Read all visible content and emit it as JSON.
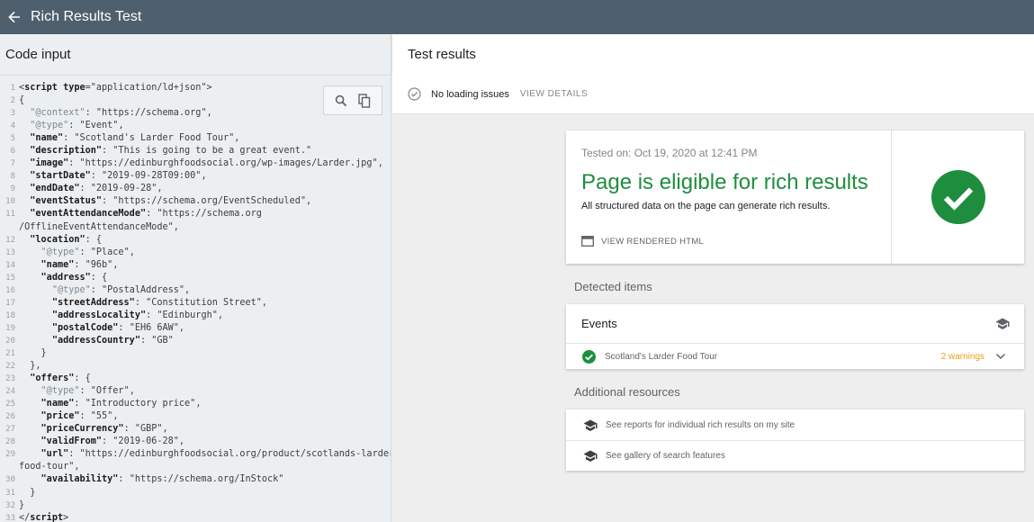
{
  "topbar": {
    "title": "Rich Results Test"
  },
  "code_panel": {
    "title": "Code input",
    "lines": [
      [
        [
          "p",
          "<"
        ],
        [
          "k",
          "script "
        ],
        [
          "k",
          "type"
        ],
        [
          "p",
          "=\"application/ld+json\">"
        ]
      ],
      [
        [
          "p",
          "{"
        ]
      ],
      [
        [
          "p",
          "  "
        ],
        [
          "kc",
          "\"@context\""
        ],
        [
          "p",
          ": "
        ],
        [
          "s",
          "\"https://schema.org\""
        ],
        [
          "p",
          ","
        ]
      ],
      [
        [
          "p",
          "  "
        ],
        [
          "kc",
          "\"@type\""
        ],
        [
          "p",
          ": "
        ],
        [
          "s",
          "\"Event\""
        ],
        [
          "p",
          ","
        ]
      ],
      [
        [
          "p",
          "  "
        ],
        [
          "k",
          "\"name\""
        ],
        [
          "p",
          ": "
        ],
        [
          "s",
          "\"Scotland's Larder Food Tour\""
        ],
        [
          "p",
          ","
        ]
      ],
      [
        [
          "p",
          "  "
        ],
        [
          "k",
          "\"description\""
        ],
        [
          "p",
          ": "
        ],
        [
          "s",
          "\"This is going to be a great event.\""
        ]
      ],
      [
        [
          "p",
          "  "
        ],
        [
          "k",
          "\"image\""
        ],
        [
          "p",
          ": "
        ],
        [
          "s",
          "\"https://edinburghfoodsocial.org/wp-images/Larder.jpg\""
        ],
        [
          "p",
          ","
        ]
      ],
      [
        [
          "p",
          "  "
        ],
        [
          "k",
          "\"startDate\""
        ],
        [
          "p",
          ": "
        ],
        [
          "s",
          "\"2019-09-28T09:00\""
        ],
        [
          "p",
          ","
        ]
      ],
      [
        [
          "p",
          "  "
        ],
        [
          "k",
          "\"endDate\""
        ],
        [
          "p",
          ": "
        ],
        [
          "s",
          "\"2019-09-28\""
        ],
        [
          "p",
          ","
        ]
      ],
      [
        [
          "p",
          "  "
        ],
        [
          "k",
          "\"eventStatus\""
        ],
        [
          "p",
          ": "
        ],
        [
          "s",
          "\"https://schema.org/EventScheduled\""
        ],
        [
          "p",
          ","
        ]
      ],
      [
        [
          "p",
          "  "
        ],
        [
          "k",
          "\"eventAttendanceMode\""
        ],
        [
          "p",
          ": "
        ],
        [
          "s",
          "\"https://schema.org"
        ]
      ],
      [
        [
          "s",
          "/OfflineEventAttendanceMode\""
        ],
        [
          "p",
          ","
        ]
      ],
      [
        [
          "p",
          "  "
        ],
        [
          "k",
          "\"location\""
        ],
        [
          "p",
          ": {"
        ]
      ],
      [
        [
          "p",
          "    "
        ],
        [
          "kc",
          "\"@type\""
        ],
        [
          "p",
          ": "
        ],
        [
          "s",
          "\"Place\""
        ],
        [
          "p",
          ","
        ]
      ],
      [
        [
          "p",
          "    "
        ],
        [
          "k",
          "\"name\""
        ],
        [
          "p",
          ": "
        ],
        [
          "s",
          "\"96b\""
        ],
        [
          "p",
          ","
        ]
      ],
      [
        [
          "p",
          "    "
        ],
        [
          "k",
          "\"address\""
        ],
        [
          "p",
          ": {"
        ]
      ],
      [
        [
          "p",
          "      "
        ],
        [
          "kc",
          "\"@type\""
        ],
        [
          "p",
          ": "
        ],
        [
          "s",
          "\"PostalAddress\""
        ],
        [
          "p",
          ","
        ]
      ],
      [
        [
          "p",
          "      "
        ],
        [
          "k",
          "\"streetAddress\""
        ],
        [
          "p",
          ": "
        ],
        [
          "s",
          "\"Constitution Street\""
        ],
        [
          "p",
          ","
        ]
      ],
      [
        [
          "p",
          "      "
        ],
        [
          "k",
          "\"addressLocality\""
        ],
        [
          "p",
          ": "
        ],
        [
          "s",
          "\"Edinburgh\""
        ],
        [
          "p",
          ","
        ]
      ],
      [
        [
          "p",
          "      "
        ],
        [
          "k",
          "\"postalCode\""
        ],
        [
          "p",
          ": "
        ],
        [
          "s",
          "\"EH6 6AW\""
        ],
        [
          "p",
          ","
        ]
      ],
      [
        [
          "p",
          "      "
        ],
        [
          "k",
          "\"addressCountry\""
        ],
        [
          "p",
          ": "
        ],
        [
          "s",
          "\"GB\""
        ]
      ],
      [
        [
          "p",
          "    }"
        ]
      ],
      [
        [
          "p",
          "  },"
        ]
      ],
      [
        [
          "p",
          "  "
        ],
        [
          "k",
          "\"offers\""
        ],
        [
          "p",
          ": {"
        ]
      ],
      [
        [
          "p",
          "    "
        ],
        [
          "kc",
          "\"@type\""
        ],
        [
          "p",
          ": "
        ],
        [
          "s",
          "\"Offer\""
        ],
        [
          "p",
          ","
        ]
      ],
      [
        [
          "p",
          "    "
        ],
        [
          "k",
          "\"name\""
        ],
        [
          "p",
          ": "
        ],
        [
          "s",
          "\"Introductory price\""
        ],
        [
          "p",
          ","
        ]
      ],
      [
        [
          "p",
          "    "
        ],
        [
          "k",
          "\"price\""
        ],
        [
          "p",
          ": "
        ],
        [
          "s",
          "\"55\""
        ],
        [
          "p",
          ","
        ]
      ],
      [
        [
          "p",
          "    "
        ],
        [
          "k",
          "\"priceCurrency\""
        ],
        [
          "p",
          ": "
        ],
        [
          "s",
          "\"GBP\""
        ],
        [
          "p",
          ","
        ]
      ],
      [
        [
          "p",
          "    "
        ],
        [
          "k",
          "\"validFrom\""
        ],
        [
          "p",
          ": "
        ],
        [
          "s",
          "\"2019-06-28\""
        ],
        [
          "p",
          ","
        ]
      ],
      [
        [
          "p",
          "    "
        ],
        [
          "k",
          "\"url\""
        ],
        [
          "p",
          ": "
        ],
        [
          "s",
          "\"https://edinburghfoodsocial.org/product/scotlands-larder-"
        ]
      ],
      [
        [
          "s",
          "food-tour\""
        ],
        [
          "p",
          ","
        ]
      ],
      [
        [
          "p",
          "    "
        ],
        [
          "k",
          "\"availability\""
        ],
        [
          "p",
          ": "
        ],
        [
          "s",
          "\"https://schema.org/InStock\""
        ]
      ],
      [
        [
          "p",
          "  }"
        ]
      ],
      [
        [
          "p",
          "}"
        ]
      ],
      [
        [
          "p",
          "</"
        ],
        [
          "k",
          "script"
        ],
        [
          "p",
          ">"
        ]
      ]
    ],
    "line_numbers": [
      "1",
      "2",
      "3",
      "4",
      "5",
      "6",
      "7",
      "8",
      "9",
      "10",
      "11",
      "",
      "12",
      "13",
      "14",
      "15",
      "16",
      "17",
      "18",
      "19",
      "20",
      "21",
      "22",
      "23",
      "24",
      "25",
      "26",
      "27",
      "28",
      "29",
      "",
      "30",
      "31",
      "32",
      "33"
    ],
    "tools": {
      "search_icon": "search-icon",
      "copy_icon": "copy-icon"
    }
  },
  "results_panel": {
    "title": "Test results",
    "status": {
      "text": "No loading issues",
      "action": "VIEW DETAILS"
    },
    "result": {
      "tested_on": "Tested on: Oct 19, 2020 at 12:41 PM",
      "headline": "Page is eligible for rich results",
      "subtext": "All structured data on the page can generate rich results.",
      "rendered_html": "VIEW RENDERED HTML"
    },
    "detected_label": "Detected items",
    "events": {
      "title": "Events",
      "item": {
        "name": "Scotland's Larder Food Tour",
        "warnings": "2 warnings"
      }
    },
    "resources_label": "Additional resources",
    "resources": [
      {
        "text": "See reports for individual rich results on my site"
      },
      {
        "text": "See gallery of search features"
      }
    ]
  },
  "colors": {
    "topbar": "#4e5f6d",
    "success": "#1e8e3e",
    "warning": "#e8a317"
  }
}
